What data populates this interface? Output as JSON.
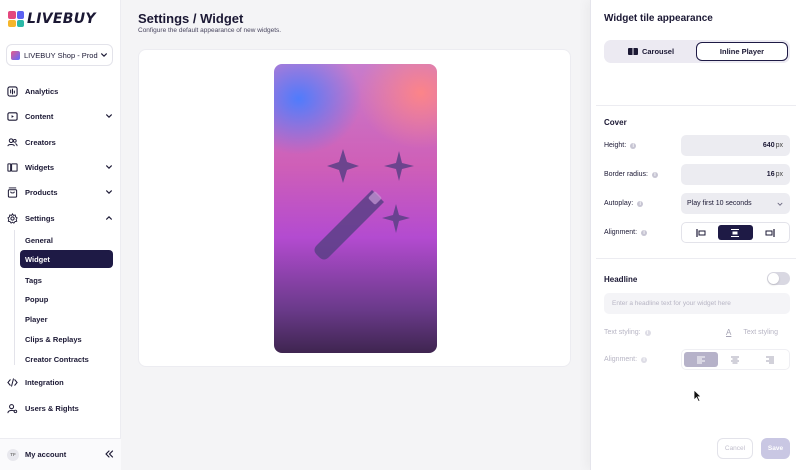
{
  "brand": {
    "logo_text": "LIVEBUY",
    "logo_colors": [
      "#e4487e",
      "#5b61f2",
      "#f5b62c",
      "#2bb9a7"
    ]
  },
  "shop": {
    "name": "LIVEBUY Shop - Prod"
  },
  "nav": {
    "analytics": "Analytics",
    "content": "Content",
    "creators": "Creators",
    "widgets": "Widgets",
    "products": "Products",
    "settings": "Settings",
    "settings_sub": [
      "General",
      "Widget",
      "Tags",
      "Popup",
      "Player",
      "Clips & Replays",
      "Creator Contracts"
    ],
    "integration": "Integration",
    "users": "Users & Rights"
  },
  "account": {
    "initials": "TF",
    "label": "My account"
  },
  "page": {
    "title": "Settings / Widget",
    "subtitle": "Configure the default appearance of new widgets."
  },
  "panel": {
    "title": "Widget tile appearance",
    "tabs": [
      "Carousel",
      "Inline Player"
    ],
    "active_tab": "Inline Player",
    "cover": {
      "section": "Cover",
      "height_label": "Height:",
      "height_value": "640",
      "height_unit": "px",
      "radius_label": "Border radius:",
      "radius_value": "16",
      "radius_unit": "px",
      "autoplay_label": "Autoplay:",
      "autoplay_value": "Play first 10 seconds",
      "alignment_label": "Alignment:",
      "alignment_selected": "center"
    },
    "headline": {
      "section": "Headline",
      "enabled": false,
      "placeholder": "Enter a headline text for your widget here",
      "text_styling_label": "Text styling:",
      "text_styling_value": "Text styling",
      "text_styling_icon": "A",
      "alignment_label": "Alignment:",
      "alignment_selected": "left"
    },
    "cancel_label": "Cancel",
    "save_label": "Save"
  },
  "colors": {
    "accent": "#1e1a45",
    "save_disabled": "#c9c7e3"
  }
}
